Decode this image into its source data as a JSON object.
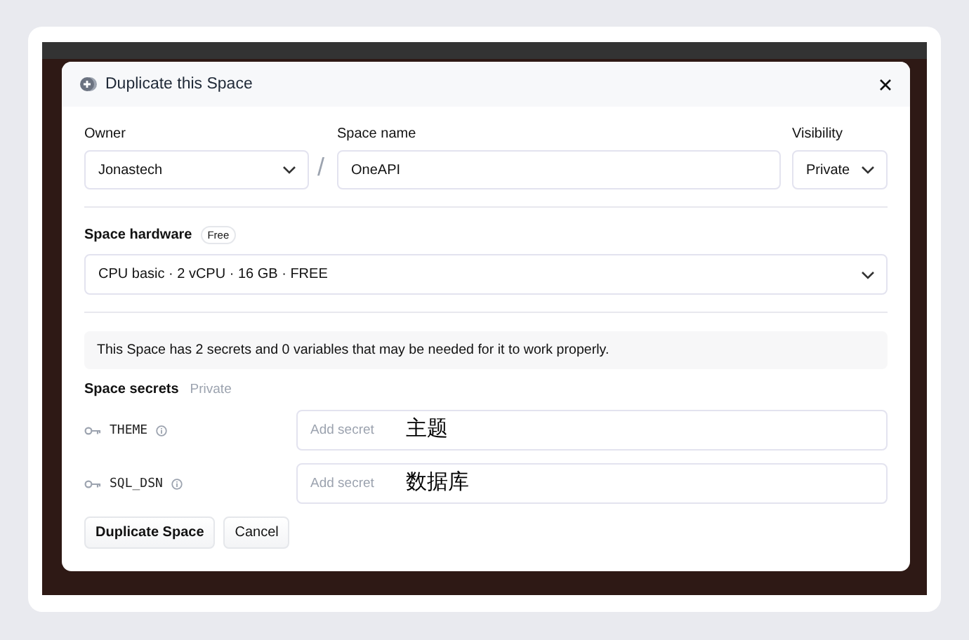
{
  "dialog": {
    "title": "Duplicate this Space"
  },
  "owner": {
    "label": "Owner",
    "value": "Jonastech"
  },
  "space_name": {
    "label": "Space name",
    "value": "OneAPI"
  },
  "separator": "/",
  "visibility": {
    "label": "Visibility",
    "value": "Private"
  },
  "hardware": {
    "label": "Space hardware",
    "badge": "Free",
    "value": "CPU basic · 2 vCPU · 16 GB · FREE"
  },
  "notice": "This Space has 2 secrets and 0 variables that may be needed for it to work properly.",
  "secrets": {
    "label": "Space secrets",
    "tag": "Private",
    "items": [
      {
        "name": "THEME",
        "placeholder": "Add secret",
        "annotation": "主题"
      },
      {
        "name": "SQL_DSN",
        "placeholder": "Add secret",
        "annotation": "数据库"
      }
    ]
  },
  "buttons": [
    {
      "label": "Duplicate Space",
      "kind": "primary"
    },
    {
      "label": "Cancel",
      "kind": "secondary"
    }
  ]
}
